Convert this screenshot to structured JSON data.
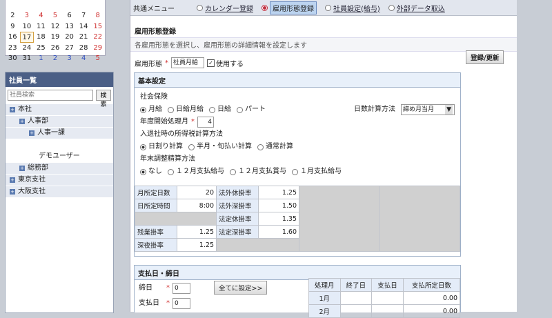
{
  "calendar": {
    "rows": [
      [
        {
          "d": "",
          "s": ""
        },
        {
          "d": "",
          "s": ""
        },
        {
          "d": "",
          "s": ""
        },
        {
          "d": "",
          "s": ""
        },
        {
          "d": "",
          "s": ""
        },
        {
          "d": "",
          "s": ""
        },
        {
          "d": "",
          "s": ""
        }
      ],
      [
        {
          "d": "2",
          "s": ""
        },
        {
          "d": "3",
          "s": "r"
        },
        {
          "d": "4",
          "s": "r"
        },
        {
          "d": "5",
          "s": "r"
        },
        {
          "d": "6",
          "s": ""
        },
        {
          "d": "7",
          "s": ""
        },
        {
          "d": "8",
          "s": "r"
        }
      ],
      [
        {
          "d": "9",
          "s": ""
        },
        {
          "d": "10",
          "s": ""
        },
        {
          "d": "11",
          "s": ""
        },
        {
          "d": "12",
          "s": ""
        },
        {
          "d": "13",
          "s": ""
        },
        {
          "d": "14",
          "s": ""
        },
        {
          "d": "15",
          "s": "r"
        }
      ],
      [
        {
          "d": "16",
          "s": ""
        },
        {
          "d": "17",
          "s": "today"
        },
        {
          "d": "18",
          "s": ""
        },
        {
          "d": "19",
          "s": ""
        },
        {
          "d": "20",
          "s": ""
        },
        {
          "d": "21",
          "s": ""
        },
        {
          "d": "22",
          "s": "r"
        }
      ],
      [
        {
          "d": "23",
          "s": ""
        },
        {
          "d": "24",
          "s": ""
        },
        {
          "d": "25",
          "s": ""
        },
        {
          "d": "26",
          "s": ""
        },
        {
          "d": "27",
          "s": ""
        },
        {
          "d": "28",
          "s": ""
        },
        {
          "d": "29",
          "s": "r"
        }
      ],
      [
        {
          "d": "30",
          "s": ""
        },
        {
          "d": "31",
          "s": ""
        },
        {
          "d": "1",
          "s": "b"
        },
        {
          "d": "2",
          "s": "b"
        },
        {
          "d": "3",
          "s": "b"
        },
        {
          "d": "4",
          "s": "b"
        },
        {
          "d": "5",
          "s": "r"
        }
      ]
    ]
  },
  "employees": {
    "title": "社員一覧",
    "search_placeholder": "社員検索",
    "search_button": "検索",
    "tree": [
      {
        "label": "本社",
        "indent": 0,
        "pm": true
      },
      {
        "label": "人事部",
        "indent": 1,
        "pm": true
      },
      {
        "label": "人事一課",
        "indent": 2,
        "pm": true
      },
      {
        "label": "",
        "indent": 3,
        "pm": false,
        "plain": true
      },
      {
        "label": "デモユーザー",
        "indent": 3,
        "pm": false,
        "plain": true
      },
      {
        "label": "総務部",
        "indent": 1,
        "pm": true
      },
      {
        "label": "東京支社",
        "indent": 0,
        "pm": true
      },
      {
        "label": "大阪支社",
        "indent": 0,
        "pm": true
      }
    ]
  },
  "menu": {
    "label": "共通メニュー",
    "items": [
      {
        "label": "カレンダー登録",
        "state": "off"
      },
      {
        "label": "雇用形態登録",
        "state": "selected"
      },
      {
        "label": "社員設定(給与)",
        "state": "off"
      },
      {
        "label": "外部データ取込",
        "state": "off"
      }
    ]
  },
  "page": {
    "title": "雇用形態登録",
    "description": "各雇用形態を選択し、雇用形態の詳細情報を設定します",
    "type_label": "雇用形態",
    "type_value": "社員月給",
    "use_label": "使用する",
    "register_button": "登録/更新"
  },
  "basic": {
    "title": "基本設定",
    "insurance_label": "社会保険",
    "insurance_options": [
      {
        "label": "月給",
        "on": true
      },
      {
        "label": "日給月給",
        "on": false
      },
      {
        "label": "日給",
        "on": false
      },
      {
        "label": "パート",
        "on": false
      }
    ],
    "daycalc_label": "日数計算方法",
    "daycalc_value": "締め月当月",
    "fiscal_label": "年度開始処理月",
    "fiscal_value": "4",
    "tax_label": "入退社時の所得税計算方法",
    "tax_options": [
      {
        "label": "日割り計算",
        "on": true
      },
      {
        "label": "半月・旬払い計算",
        "on": false
      },
      {
        "label": "通常計算",
        "on": false
      }
    ],
    "yearend_label": "年末調整精算方法",
    "yearend_options": [
      {
        "label": "なし",
        "on": true
      },
      {
        "label": "１２月支払給与",
        "on": false
      },
      {
        "label": "１２月支払賞与",
        "on": false
      },
      {
        "label": "１月支払給与",
        "on": false
      }
    ],
    "grid": {
      "monthly_days_label": "月所定日数",
      "monthly_days": "20",
      "daily_hours_label": "日所定時間",
      "daily_hours": "8:00",
      "overtime_label": "残業掛率",
      "overtime": "1.25",
      "latenight_label": "深夜掛率",
      "latenight": "1.25",
      "legal_out_holiday_label": "法外休掛率",
      "legal_out_holiday": "1.25",
      "legal_out_late_label": "法外深掛率",
      "legal_out_late": "1.50",
      "legal_holiday_label": "法定休掛率",
      "legal_holiday": "1.35",
      "legal_late_label": "法定深掛率",
      "legal_late": "1.60"
    }
  },
  "pay": {
    "title": "支払日・締日",
    "close_label": "締日",
    "close_value": "0",
    "pay_label": "支払日",
    "pay_value": "0",
    "set_all_button": "全てに設定>>",
    "headers": [
      "処理月",
      "終了日",
      "支払日",
      "支払所定日数"
    ],
    "rows": [
      {
        "month": "1月",
        "end": "",
        "pay": "",
        "days": "0.00"
      },
      {
        "month": "2月",
        "end": "",
        "pay": "",
        "days": "0.00"
      }
    ]
  },
  "colors": {
    "header": "#4b5f86",
    "section": "#e8f0fa",
    "required": "#d03030"
  }
}
